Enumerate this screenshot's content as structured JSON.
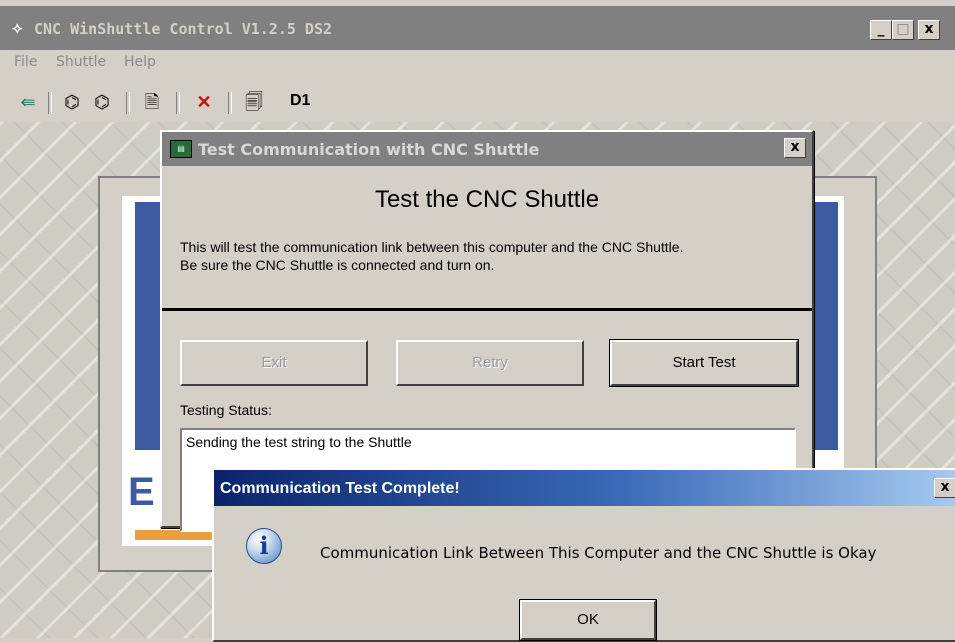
{
  "main_window": {
    "title": "CNC WinShuttle Control V1.2.5  DS2",
    "controls": {
      "minimize": "_",
      "maximize": "□",
      "close": "x"
    }
  },
  "menu": [
    "File",
    "Shuttle",
    "Help"
  ],
  "toolbar": {
    "icons": [
      "exit-icon",
      "shuttle-icon-1",
      "shuttle-icon-2",
      "new-icon",
      "delete-icon",
      "properties-icon"
    ],
    "label": "D1"
  },
  "background": {
    "letter": "E"
  },
  "test_dialog": {
    "title": "Test Communication with CNC Shuttle",
    "heading": "Test the CNC Shuttle",
    "description_line1": "This will test the communication link between this computer and the CNC Shuttle.",
    "description_line2": "Be sure the CNC Shuttle is connected and turn on.",
    "buttons": {
      "exit": "Exit",
      "retry": "Retry",
      "start": "Start Test"
    },
    "status_label": "Testing Status:",
    "status_text": "Sending the test string to the Shuttle",
    "close": "x"
  },
  "message_box": {
    "title": "Communication Test Complete!",
    "text": "Communication Link Between This Computer and the CNC Shuttle is Okay",
    "ok": "OK",
    "close": "x",
    "icon": "information-icon"
  }
}
